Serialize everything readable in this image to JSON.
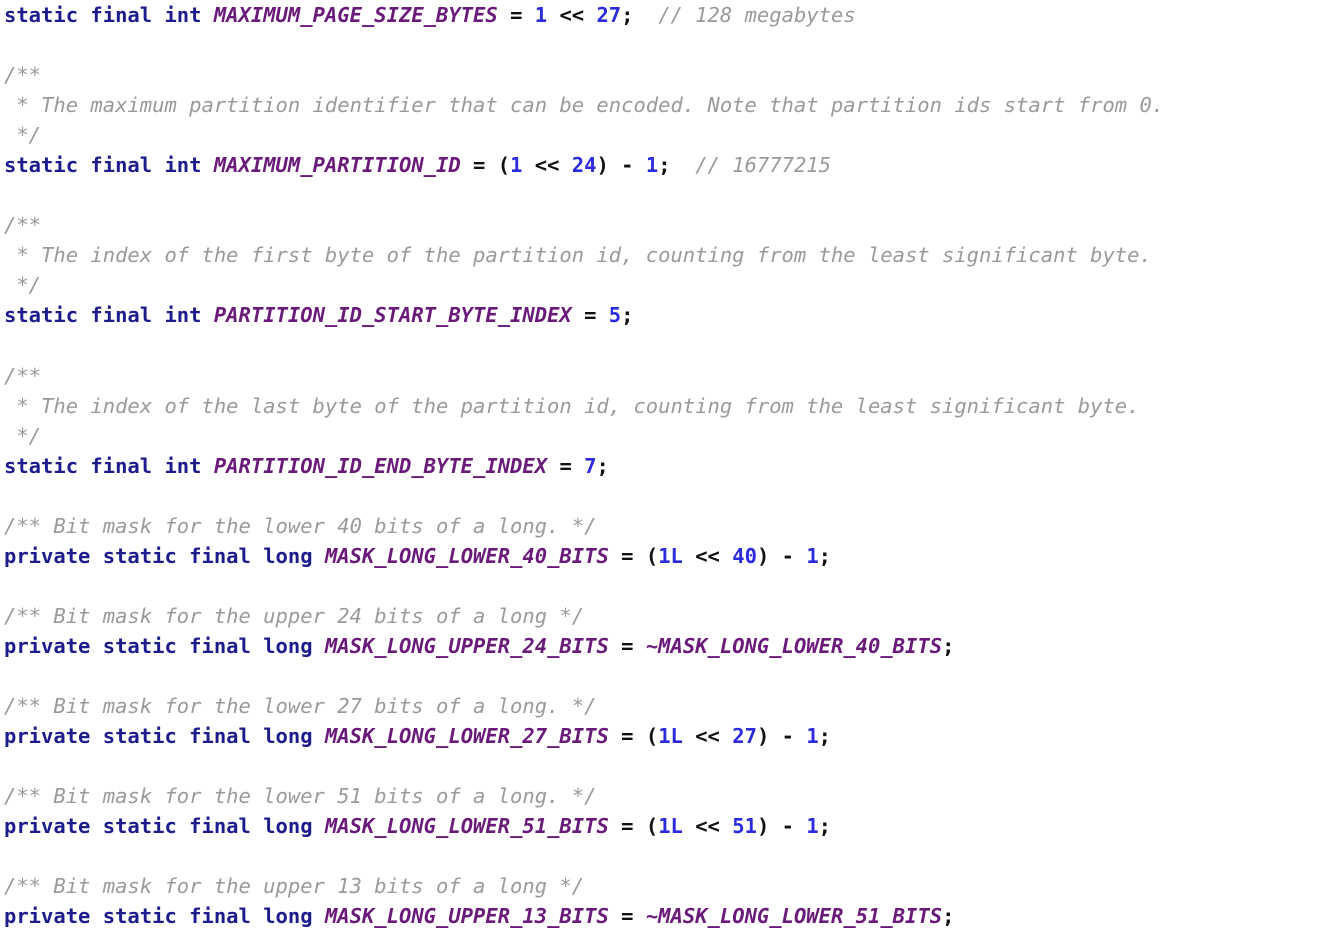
{
  "editor": {
    "title": "Java source code fragment",
    "language": "java",
    "background_color": "#ffffff",
    "colors": {
      "keyword": "#1c1c8c",
      "identifier": "#6a1b7a",
      "number": "#2b2bdd",
      "punctuation": "#111111",
      "comment": "#9a9a9a"
    }
  },
  "code": {
    "lines": [
      {
        "index": 1,
        "text": "static final int MAXIMUM_PAGE_SIZE_BYTES = 1 << 27;  // 128 megabytes",
        "tokens": [
          {
            "t": "static",
            "k": "kw"
          },
          {
            "t": " ",
            "k": "plain"
          },
          {
            "t": "final",
            "k": "kw"
          },
          {
            "t": " ",
            "k": "plain"
          },
          {
            "t": "int",
            "k": "kw"
          },
          {
            "t": " ",
            "k": "plain"
          },
          {
            "t": "MAXIMUM_PAGE_SIZE_BYTES",
            "k": "ident"
          },
          {
            "t": " ",
            "k": "plain"
          },
          {
            "t": "=",
            "k": "punct"
          },
          {
            "t": " ",
            "k": "plain"
          },
          {
            "t": "1",
            "k": "num"
          },
          {
            "t": " ",
            "k": "plain"
          },
          {
            "t": "<<",
            "k": "punct"
          },
          {
            "t": " ",
            "k": "plain"
          },
          {
            "t": "27",
            "k": "num"
          },
          {
            "t": ";",
            "k": "punct"
          },
          {
            "t": "  ",
            "k": "plain"
          },
          {
            "t": "// 128 megabytes",
            "k": "comment"
          }
        ]
      },
      {
        "index": 2,
        "text": "",
        "tokens": []
      },
      {
        "index": 3,
        "text": "/**",
        "tokens": [
          {
            "t": "/**",
            "k": "comment"
          }
        ]
      },
      {
        "index": 4,
        "text": " * The maximum partition identifier that can be encoded. Note that partition ids start from 0.",
        "tokens": [
          {
            "t": " * The maximum partition identifier that can be encoded. Note that partition ids start from 0.",
            "k": "comment"
          }
        ]
      },
      {
        "index": 5,
        "text": " */",
        "tokens": [
          {
            "t": " */",
            "k": "comment"
          }
        ]
      },
      {
        "index": 6,
        "text": "static final int MAXIMUM_PARTITION_ID = (1 << 24) - 1;  // 16777215",
        "tokens": [
          {
            "t": "static",
            "k": "kw"
          },
          {
            "t": " ",
            "k": "plain"
          },
          {
            "t": "final",
            "k": "kw"
          },
          {
            "t": " ",
            "k": "plain"
          },
          {
            "t": "int",
            "k": "kw"
          },
          {
            "t": " ",
            "k": "plain"
          },
          {
            "t": "MAXIMUM_PARTITION_ID",
            "k": "ident"
          },
          {
            "t": " ",
            "k": "plain"
          },
          {
            "t": "=",
            "k": "punct"
          },
          {
            "t": " ",
            "k": "plain"
          },
          {
            "t": "(",
            "k": "punct"
          },
          {
            "t": "1",
            "k": "num"
          },
          {
            "t": " ",
            "k": "plain"
          },
          {
            "t": "<<",
            "k": "punct"
          },
          {
            "t": " ",
            "k": "plain"
          },
          {
            "t": "24",
            "k": "num"
          },
          {
            "t": ")",
            "k": "punct"
          },
          {
            "t": " ",
            "k": "plain"
          },
          {
            "t": "-",
            "k": "punct"
          },
          {
            "t": " ",
            "k": "plain"
          },
          {
            "t": "1",
            "k": "num"
          },
          {
            "t": ";",
            "k": "punct"
          },
          {
            "t": "  ",
            "k": "plain"
          },
          {
            "t": "// 16777215",
            "k": "comment"
          }
        ]
      },
      {
        "index": 7,
        "text": "",
        "tokens": []
      },
      {
        "index": 8,
        "text": "/**",
        "tokens": [
          {
            "t": "/**",
            "k": "comment"
          }
        ]
      },
      {
        "index": 9,
        "text": " * The index of the first byte of the partition id, counting from the least significant byte.",
        "tokens": [
          {
            "t": " * The index of the first byte of the partition id, counting from the least significant byte.",
            "k": "comment"
          }
        ]
      },
      {
        "index": 10,
        "text": " */",
        "tokens": [
          {
            "t": " */",
            "k": "comment"
          }
        ]
      },
      {
        "index": 11,
        "text": "static final int PARTITION_ID_START_BYTE_INDEX = 5;",
        "tokens": [
          {
            "t": "static",
            "k": "kw"
          },
          {
            "t": " ",
            "k": "plain"
          },
          {
            "t": "final",
            "k": "kw"
          },
          {
            "t": " ",
            "k": "plain"
          },
          {
            "t": "int",
            "k": "kw"
          },
          {
            "t": " ",
            "k": "plain"
          },
          {
            "t": "PARTITION_ID_START_BYTE_INDEX",
            "k": "ident"
          },
          {
            "t": " ",
            "k": "plain"
          },
          {
            "t": "=",
            "k": "punct"
          },
          {
            "t": " ",
            "k": "plain"
          },
          {
            "t": "5",
            "k": "num"
          },
          {
            "t": ";",
            "k": "punct"
          }
        ]
      },
      {
        "index": 12,
        "text": "",
        "tokens": []
      },
      {
        "index": 13,
        "text": "/**",
        "tokens": [
          {
            "t": "/**",
            "k": "comment"
          }
        ]
      },
      {
        "index": 14,
        "text": " * The index of the last byte of the partition id, counting from the least significant byte.",
        "tokens": [
          {
            "t": " * The index of the last byte of the partition id, counting from the least significant byte.",
            "k": "comment"
          }
        ]
      },
      {
        "index": 15,
        "text": " */",
        "tokens": [
          {
            "t": " */",
            "k": "comment"
          }
        ]
      },
      {
        "index": 16,
        "text": "static final int PARTITION_ID_END_BYTE_INDEX = 7;",
        "tokens": [
          {
            "t": "static",
            "k": "kw"
          },
          {
            "t": " ",
            "k": "plain"
          },
          {
            "t": "final",
            "k": "kw"
          },
          {
            "t": " ",
            "k": "plain"
          },
          {
            "t": "int",
            "k": "kw"
          },
          {
            "t": " ",
            "k": "plain"
          },
          {
            "t": "PARTITION_ID_END_BYTE_INDEX",
            "k": "ident"
          },
          {
            "t": " ",
            "k": "plain"
          },
          {
            "t": "=",
            "k": "punct"
          },
          {
            "t": " ",
            "k": "plain"
          },
          {
            "t": "7",
            "k": "num"
          },
          {
            "t": ";",
            "k": "punct"
          }
        ]
      },
      {
        "index": 17,
        "text": "",
        "tokens": []
      },
      {
        "index": 18,
        "text": "/** Bit mask for the lower 40 bits of a long. */",
        "tokens": [
          {
            "t": "/** Bit mask for the lower 40 bits of a long. */",
            "k": "comment"
          }
        ]
      },
      {
        "index": 19,
        "text": "private static final long MASK_LONG_LOWER_40_BITS = (1L << 40) - 1;",
        "tokens": [
          {
            "t": "private",
            "k": "kw"
          },
          {
            "t": " ",
            "k": "plain"
          },
          {
            "t": "static",
            "k": "kw"
          },
          {
            "t": " ",
            "k": "plain"
          },
          {
            "t": "final",
            "k": "kw"
          },
          {
            "t": " ",
            "k": "plain"
          },
          {
            "t": "long",
            "k": "kw"
          },
          {
            "t": " ",
            "k": "plain"
          },
          {
            "t": "MASK_LONG_LOWER_40_BITS",
            "k": "ident"
          },
          {
            "t": " ",
            "k": "plain"
          },
          {
            "t": "=",
            "k": "punct"
          },
          {
            "t": " ",
            "k": "plain"
          },
          {
            "t": "(",
            "k": "punct"
          },
          {
            "t": "1L",
            "k": "num"
          },
          {
            "t": " ",
            "k": "plain"
          },
          {
            "t": "<<",
            "k": "punct"
          },
          {
            "t": " ",
            "k": "plain"
          },
          {
            "t": "40",
            "k": "num"
          },
          {
            "t": ")",
            "k": "punct"
          },
          {
            "t": " ",
            "k": "plain"
          },
          {
            "t": "-",
            "k": "punct"
          },
          {
            "t": " ",
            "k": "plain"
          },
          {
            "t": "1",
            "k": "num"
          },
          {
            "t": ";",
            "k": "punct"
          }
        ]
      },
      {
        "index": 20,
        "text": "",
        "tokens": []
      },
      {
        "index": 21,
        "text": "/** Bit mask for the upper 24 bits of a long */",
        "tokens": [
          {
            "t": "/** Bit mask for the upper 24 bits of a long */",
            "k": "comment"
          }
        ]
      },
      {
        "index": 22,
        "text": "private static final long MASK_LONG_UPPER_24_BITS = ~MASK_LONG_LOWER_40_BITS;",
        "tokens": [
          {
            "t": "private",
            "k": "kw"
          },
          {
            "t": " ",
            "k": "plain"
          },
          {
            "t": "static",
            "k": "kw"
          },
          {
            "t": " ",
            "k": "plain"
          },
          {
            "t": "final",
            "k": "kw"
          },
          {
            "t": " ",
            "k": "plain"
          },
          {
            "t": "long",
            "k": "kw"
          },
          {
            "t": " ",
            "k": "plain"
          },
          {
            "t": "MASK_LONG_UPPER_24_BITS",
            "k": "ident"
          },
          {
            "t": " ",
            "k": "plain"
          },
          {
            "t": "=",
            "k": "punct"
          },
          {
            "t": " ",
            "k": "plain"
          },
          {
            "t": "~MASK_LONG_LOWER_40_BITS",
            "k": "ident"
          },
          {
            "t": ";",
            "k": "punct"
          }
        ]
      },
      {
        "index": 23,
        "text": "",
        "tokens": []
      },
      {
        "index": 24,
        "text": "/** Bit mask for the lower 27 bits of a long. */",
        "tokens": [
          {
            "t": "/** Bit mask for the lower 27 bits of a long. */",
            "k": "comment"
          }
        ]
      },
      {
        "index": 25,
        "text": "private static final long MASK_LONG_LOWER_27_BITS = (1L << 27) - 1;",
        "tokens": [
          {
            "t": "private",
            "k": "kw"
          },
          {
            "t": " ",
            "k": "plain"
          },
          {
            "t": "static",
            "k": "kw"
          },
          {
            "t": " ",
            "k": "plain"
          },
          {
            "t": "final",
            "k": "kw"
          },
          {
            "t": " ",
            "k": "plain"
          },
          {
            "t": "long",
            "k": "kw"
          },
          {
            "t": " ",
            "k": "plain"
          },
          {
            "t": "MASK_LONG_LOWER_27_BITS",
            "k": "ident"
          },
          {
            "t": " ",
            "k": "plain"
          },
          {
            "t": "=",
            "k": "punct"
          },
          {
            "t": " ",
            "k": "plain"
          },
          {
            "t": "(",
            "k": "punct"
          },
          {
            "t": "1L",
            "k": "num"
          },
          {
            "t": " ",
            "k": "plain"
          },
          {
            "t": "<<",
            "k": "punct"
          },
          {
            "t": " ",
            "k": "plain"
          },
          {
            "t": "27",
            "k": "num"
          },
          {
            "t": ")",
            "k": "punct"
          },
          {
            "t": " ",
            "k": "plain"
          },
          {
            "t": "-",
            "k": "punct"
          },
          {
            "t": " ",
            "k": "plain"
          },
          {
            "t": "1",
            "k": "num"
          },
          {
            "t": ";",
            "k": "punct"
          }
        ]
      },
      {
        "index": 26,
        "text": "",
        "tokens": []
      },
      {
        "index": 27,
        "text": "/** Bit mask for the lower 51 bits of a long. */",
        "tokens": [
          {
            "t": "/** Bit mask for the lower 51 bits of a long. */",
            "k": "comment"
          }
        ]
      },
      {
        "index": 28,
        "text": "private static final long MASK_LONG_LOWER_51_BITS = (1L << 51) - 1;",
        "tokens": [
          {
            "t": "private",
            "k": "kw"
          },
          {
            "t": " ",
            "k": "plain"
          },
          {
            "t": "static",
            "k": "kw"
          },
          {
            "t": " ",
            "k": "plain"
          },
          {
            "t": "final",
            "k": "kw"
          },
          {
            "t": " ",
            "k": "plain"
          },
          {
            "t": "long",
            "k": "kw"
          },
          {
            "t": " ",
            "k": "plain"
          },
          {
            "t": "MASK_LONG_LOWER_51_BITS",
            "k": "ident"
          },
          {
            "t": " ",
            "k": "plain"
          },
          {
            "t": "=",
            "k": "punct"
          },
          {
            "t": " ",
            "k": "plain"
          },
          {
            "t": "(",
            "k": "punct"
          },
          {
            "t": "1L",
            "k": "num"
          },
          {
            "t": " ",
            "k": "plain"
          },
          {
            "t": "<<",
            "k": "punct"
          },
          {
            "t": " ",
            "k": "plain"
          },
          {
            "t": "51",
            "k": "num"
          },
          {
            "t": ")",
            "k": "punct"
          },
          {
            "t": " ",
            "k": "plain"
          },
          {
            "t": "-",
            "k": "punct"
          },
          {
            "t": " ",
            "k": "plain"
          },
          {
            "t": "1",
            "k": "num"
          },
          {
            "t": ";",
            "k": "punct"
          }
        ]
      },
      {
        "index": 29,
        "text": "",
        "tokens": []
      },
      {
        "index": 30,
        "text": "/** Bit mask for the upper 13 bits of a long */",
        "tokens": [
          {
            "t": "/** Bit mask for the upper 13 bits of a long */",
            "k": "comment"
          }
        ]
      },
      {
        "index": 31,
        "text": "private static final long MASK_LONG_UPPER_13_BITS = ~MASK_LONG_LOWER_51_BITS;",
        "tokens": [
          {
            "t": "private",
            "k": "kw"
          },
          {
            "t": " ",
            "k": "plain"
          },
          {
            "t": "static",
            "k": "kw"
          },
          {
            "t": " ",
            "k": "plain"
          },
          {
            "t": "final",
            "k": "kw"
          },
          {
            "t": " ",
            "k": "plain"
          },
          {
            "t": "long",
            "k": "kw"
          },
          {
            "t": " ",
            "k": "plain"
          },
          {
            "t": "MASK_LONG_UPPER_13_BITS",
            "k": "ident"
          },
          {
            "t": " ",
            "k": "plain"
          },
          {
            "t": "=",
            "k": "punct"
          },
          {
            "t": " ",
            "k": "plain"
          },
          {
            "t": "~MASK_LONG_LOWER_51_BITS",
            "k": "ident"
          },
          {
            "t": ";",
            "k": "punct"
          }
        ]
      }
    ]
  }
}
